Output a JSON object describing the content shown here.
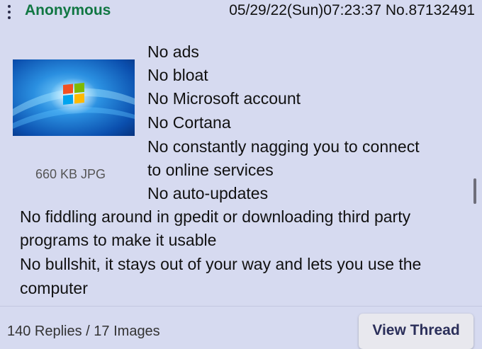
{
  "post": {
    "name": "Anonymous",
    "datetime": "05/29/22(Sun)07:23:37",
    "number_label": "No.87132491",
    "file_info": "660 KB JPG",
    "lines": [
      "No ads",
      "No bloat",
      "No Microsoft account",
      "No Cortana",
      "No constantly nagging you to connect",
      "to online services",
      "No auto-updates",
      "No fiddling around in gpedit or downloading third party",
      "programs to make it usable",
      "No bullshit, it stays out of your way and lets you use the",
      "computer"
    ]
  },
  "footer": {
    "stats": "140 Replies / 17 Images",
    "view_thread_label": "View Thread"
  },
  "icons": {
    "menu": "vertical-dots-menu-icon",
    "thumbnail": "windows-7-wallpaper-thumbnail"
  },
  "colors": {
    "background": "#d6daf0",
    "name": "#117743",
    "text": "#111111",
    "button_text": "#2b2f5a"
  }
}
